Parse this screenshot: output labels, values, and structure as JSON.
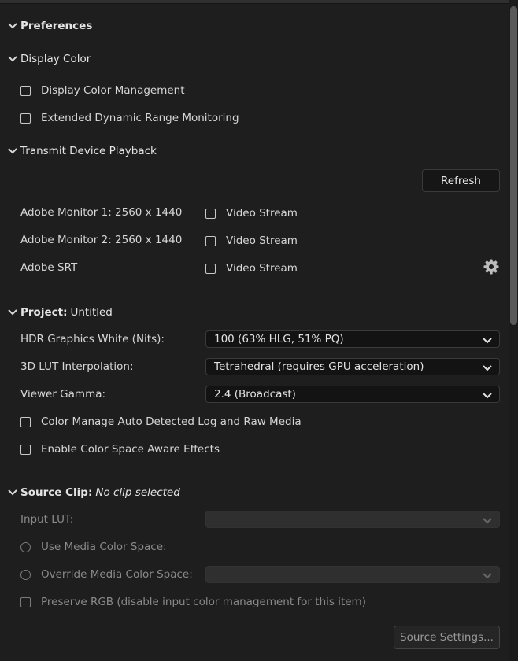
{
  "preferences": {
    "title": "Preferences"
  },
  "display_color": {
    "title": "Display Color",
    "display_color_management": "Display Color Management",
    "extended_dynamic_range": "Extended Dynamic Range Monitoring"
  },
  "transmit": {
    "title": "Transmit Device Playback",
    "refresh_label": "Refresh",
    "devices": [
      {
        "name": "Adobe Monitor 1: 2560 x 1440",
        "option": "Video Stream"
      },
      {
        "name": "Adobe Monitor 2: 2560 x 1440",
        "option": "Video Stream"
      },
      {
        "name": "Adobe SRT",
        "option": "Video Stream"
      }
    ]
  },
  "project": {
    "title_bold": "Project:",
    "title_value": "Untitled",
    "hdr_label": "HDR Graphics White (Nits):",
    "hdr_value": "100 (63% HLG, 51% PQ)",
    "lut_label": "3D LUT Interpolation:",
    "lut_value": "Tetrahedral (requires GPU acceleration)",
    "gamma_label": "Viewer Gamma:",
    "gamma_value": "2.4 (Broadcast)",
    "auto_detect_label": "Color Manage Auto Detected Log and Raw Media",
    "color_space_aware_label": "Enable Color Space Aware Effects"
  },
  "source_clip": {
    "title_bold": "Source Clip:",
    "title_value": "No clip selected",
    "input_lut_label": "Input LUT:",
    "use_media_label": "Use Media Color Space:",
    "override_label": "Override Media Color Space:",
    "preserve_rgb_label": "Preserve RGB (disable input color management for this item)",
    "source_settings_label": "Source Settings..."
  },
  "colors": {
    "background": "#1e1e1e",
    "text": "#d6d6d6",
    "disabled_text": "#8a8a8a"
  }
}
